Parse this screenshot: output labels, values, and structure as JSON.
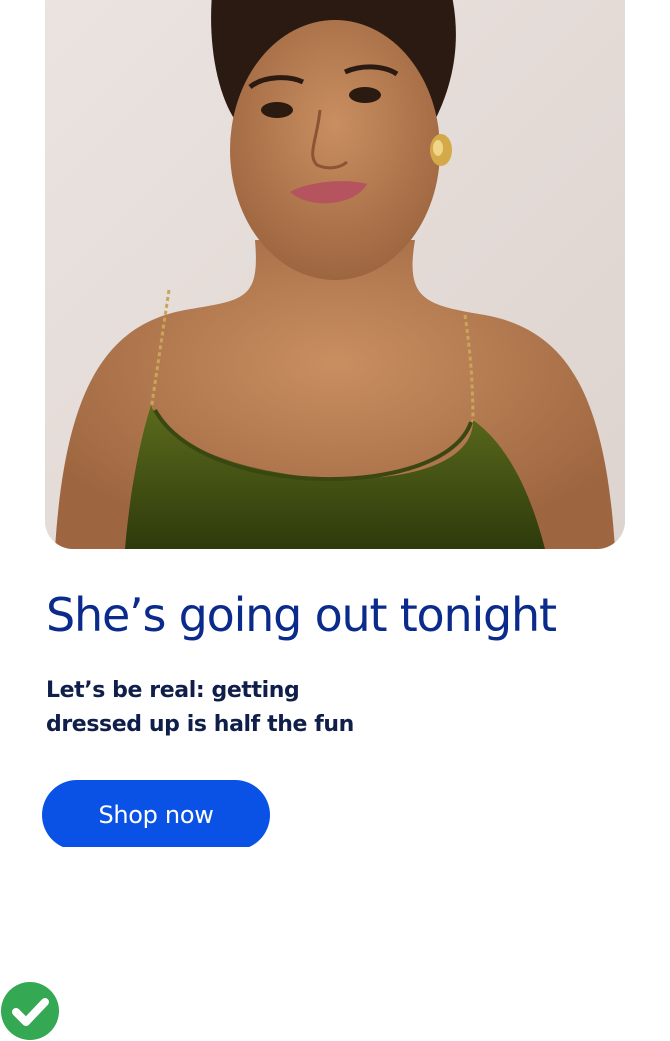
{
  "hero": {
    "image_subject": "woman in green velvet dress with chain straps",
    "background_color": "#e7dfdb"
  },
  "promo": {
    "headline": "She’s going out tonight",
    "subtext": "Let’s be real: getting dressed up is half the fun",
    "cta_label": "Shop now"
  },
  "status": {
    "icon": "check-circle-icon",
    "color": "#34a853"
  },
  "colors": {
    "headline": "#0a2a8c",
    "subtext": "#0f1f4a",
    "cta_background": "#0a52e6",
    "cta_text": "#ffffff"
  }
}
